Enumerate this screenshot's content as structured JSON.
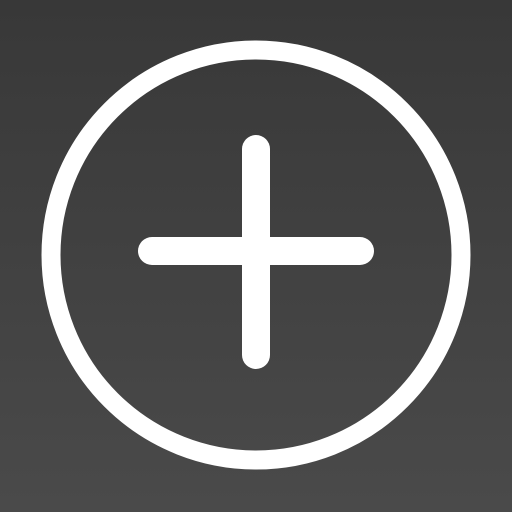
{
  "icon": {
    "name": "add-circle-icon",
    "glyph": "plus",
    "background_top": "#383838",
    "background_bottom": "#4a4a4a",
    "foreground": "#ffffff"
  }
}
